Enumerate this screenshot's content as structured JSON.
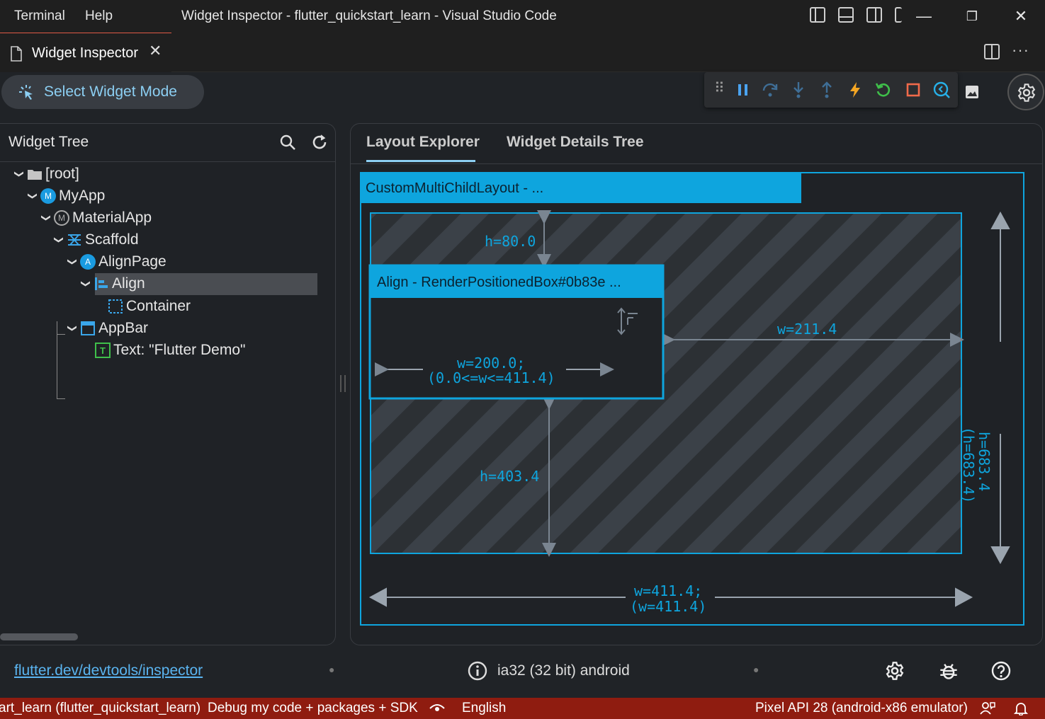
{
  "titlebar": {
    "menu_terminal": "Terminal",
    "menu_help": "Help",
    "title": "Widget Inspector - flutter_quickstart_learn - Visual Studio Code"
  },
  "tabbar": {
    "tab_label": "Widget Inspector"
  },
  "inspector": {
    "select_widget_mode": "Select Widget Mode",
    "tree_title": "Widget Tree",
    "tree": [
      {
        "label": "[root]",
        "icon": "folder-icon"
      },
      {
        "label": "MyApp",
        "icon": "stateless-m-icon"
      },
      {
        "label": "MaterialApp",
        "icon": "material-m-icon"
      },
      {
        "label": "Scaffold",
        "icon": "scaffold-icon"
      },
      {
        "label": "AlignPage",
        "icon": "stateful-a-icon"
      },
      {
        "label": "Align",
        "icon": "align-icon"
      },
      {
        "label": "Container",
        "icon": "container-icon"
      },
      {
        "label": "AppBar",
        "icon": "appbar-icon"
      },
      {
        "label": "Text: \"Flutter Demo\"",
        "icon": "text-icon"
      }
    ],
    "tabs": {
      "layout_explorer": "Layout Explorer",
      "widget_details_tree": "Widget Details Tree"
    },
    "layout": {
      "parent_title": "CustomMultiChildLayout - ...",
      "child_title": "Align - RenderPositionedBox#0b83e ...",
      "top_height": "h=80.0",
      "bottom_height": "h=403.4",
      "right_width": "w=211.4",
      "child_width": "w=200.0;",
      "child_width_constraint": "(0.0<=w<=411.4)",
      "outer_width": "w=411.4;",
      "outer_width_constraint": "(w=411.4)",
      "outer_height": "h=683.4",
      "outer_height_constraint": "(h=683.4)"
    },
    "accent_color": "#0ea5de"
  },
  "footer": {
    "link": "flutter.dev/devtools/inspector",
    "platform": "ia32 (32 bit) android"
  },
  "statusbar": {
    "project": "art_learn (flutter_quickstart_learn)",
    "debug_config": "Debug my code + packages + SDK",
    "language": "English",
    "device": "Pixel API 28 (android-x86 emulator)"
  }
}
